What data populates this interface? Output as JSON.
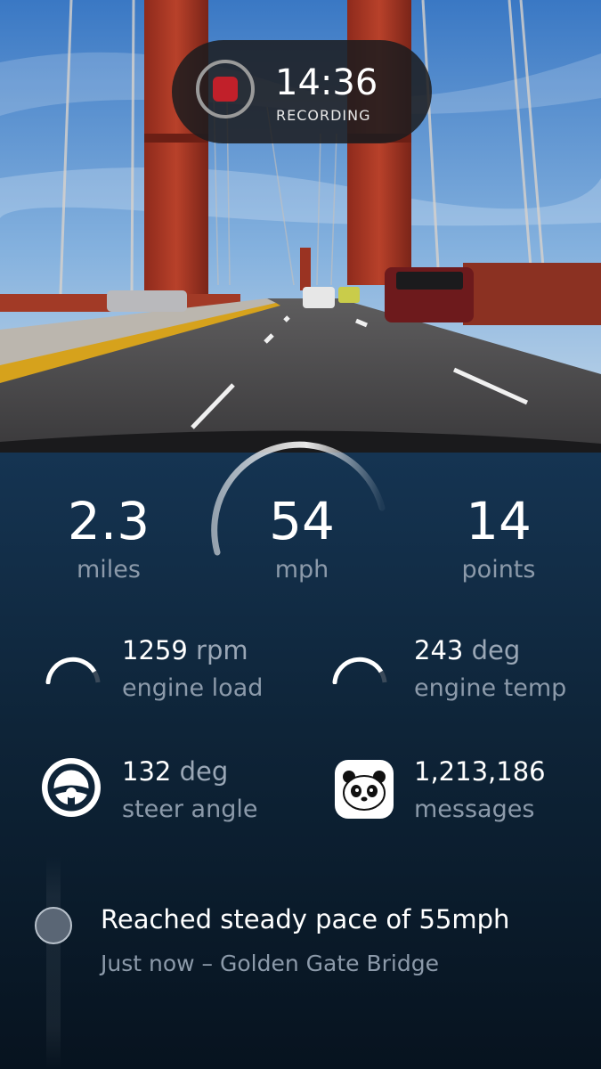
{
  "recording": {
    "time": "14:36",
    "label": "RECORDING",
    "stop_color": "#c1202a"
  },
  "camera_view": {
    "icon": "camera-feed",
    "scene": "Golden Gate Bridge"
  },
  "stats": [
    {
      "value": "2.3",
      "unit": "miles"
    },
    {
      "value": "54",
      "unit": "mph"
    },
    {
      "value": "14",
      "unit": "points"
    }
  ],
  "metrics": {
    "engine_load": {
      "value": "1259",
      "unit": "rpm",
      "label": "engine load",
      "icon": "gauge-icon"
    },
    "engine_temp": {
      "value": "243",
      "unit": "deg",
      "label": "engine temp",
      "icon": "gauge-icon"
    },
    "steer_angle": {
      "value": "132",
      "unit": "deg",
      "label": "steer angle",
      "icon": "steering-wheel-icon"
    },
    "messages": {
      "value": "1,213,186",
      "label": "messages",
      "icon": "panda-icon"
    }
  },
  "event": {
    "title": "Reached steady pace of 55mph",
    "subtitle": "Just now – Golden Gate Bridge"
  },
  "colors": {
    "accent_red": "#c1202a",
    "dashboard_top": "#153452",
    "dashboard_bottom": "#07131f",
    "muted_text": "#8c9aaa"
  }
}
